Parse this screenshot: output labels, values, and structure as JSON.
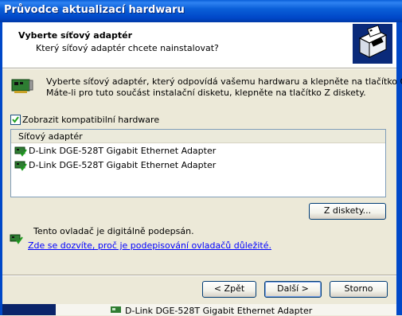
{
  "window": {
    "title": "Průvodce aktualizací hardwaru"
  },
  "header": {
    "title": "Vyberte síťový adaptér",
    "subtitle": "Který síťový adaptér chcete nainstalovat?"
  },
  "intro": {
    "line1": "Vyberte síťový adaptér, který odpovídá vašemu hardwaru a klepněte na tlačítko OK.",
    "line2": "Máte-li pro tuto součást instalační disketu, klepněte na tlačítko Z diskety."
  },
  "compatible_checkbox": {
    "label": "Zobrazit kompatibilní hardware",
    "checked": true
  },
  "adapter_list": {
    "column_header": "Síťový adaptér",
    "items": [
      {
        "label": "D-Link DGE-528T Gigabit Ethernet Adapter"
      },
      {
        "label": "D-Link DGE-528T Gigabit Ethernet Adapter"
      }
    ]
  },
  "buttons": {
    "from_disk": "Z diskety...",
    "back": "< Zpět",
    "next": "Další >",
    "cancel": "Storno"
  },
  "signature": {
    "text": "Tento ovladač je digitálně podepsán.",
    "link": "Zde se dozvíte, proč je podepisování ovladačů důležité."
  },
  "background_window": {
    "item_label": "D-Link DGE-528T Gigabit Ethernet Adapter"
  },
  "icons": {
    "wizard": "hardware-wizard-icon",
    "network_card": "network-card-icon",
    "adapter": "network-adapter-icon",
    "signed": "signed-driver-icon"
  },
  "colors": {
    "titlebar": "#0a5fd8",
    "link": "#0000ff",
    "dialog_bg": "#ece9d8"
  }
}
